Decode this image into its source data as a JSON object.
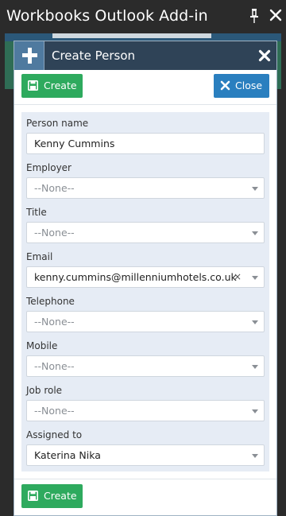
{
  "pane": {
    "title": "Workbooks Outlook Add-in",
    "pin_icon": "pin-icon",
    "close_icon": "close-icon"
  },
  "modal": {
    "title": "Create Person",
    "header_icon": "plus-icon",
    "close_icon": "close-x-icon"
  },
  "toolbar": {
    "create_label": "Create",
    "close_label": "Close"
  },
  "footer": {
    "create_label": "Create"
  },
  "form": {
    "fields": [
      {
        "label": "Person name",
        "value": "Kenny Cummins",
        "type": "text"
      },
      {
        "label": "Employer",
        "value": "--None--",
        "type": "select"
      },
      {
        "label": "Title",
        "value": "--None--",
        "type": "select"
      },
      {
        "label": "Email",
        "value": "kenny.cummins@millenniumhotels.co.uk",
        "type": "select",
        "clear": "×"
      },
      {
        "label": "Telephone",
        "value": "--None--",
        "type": "select"
      },
      {
        "label": "Mobile",
        "value": "--None--",
        "type": "select"
      },
      {
        "label": "Job role",
        "value": "--None--",
        "type": "select"
      },
      {
        "label": "Assigned to",
        "value": "Katerina Nika",
        "type": "select"
      }
    ]
  },
  "colors": {
    "pane_bg": "#2b2b2b",
    "modal_header": "#2f4357",
    "create_green": "#2eaa5e",
    "close_blue": "#2a7fbf",
    "form_bg": "#e6ecf5"
  }
}
